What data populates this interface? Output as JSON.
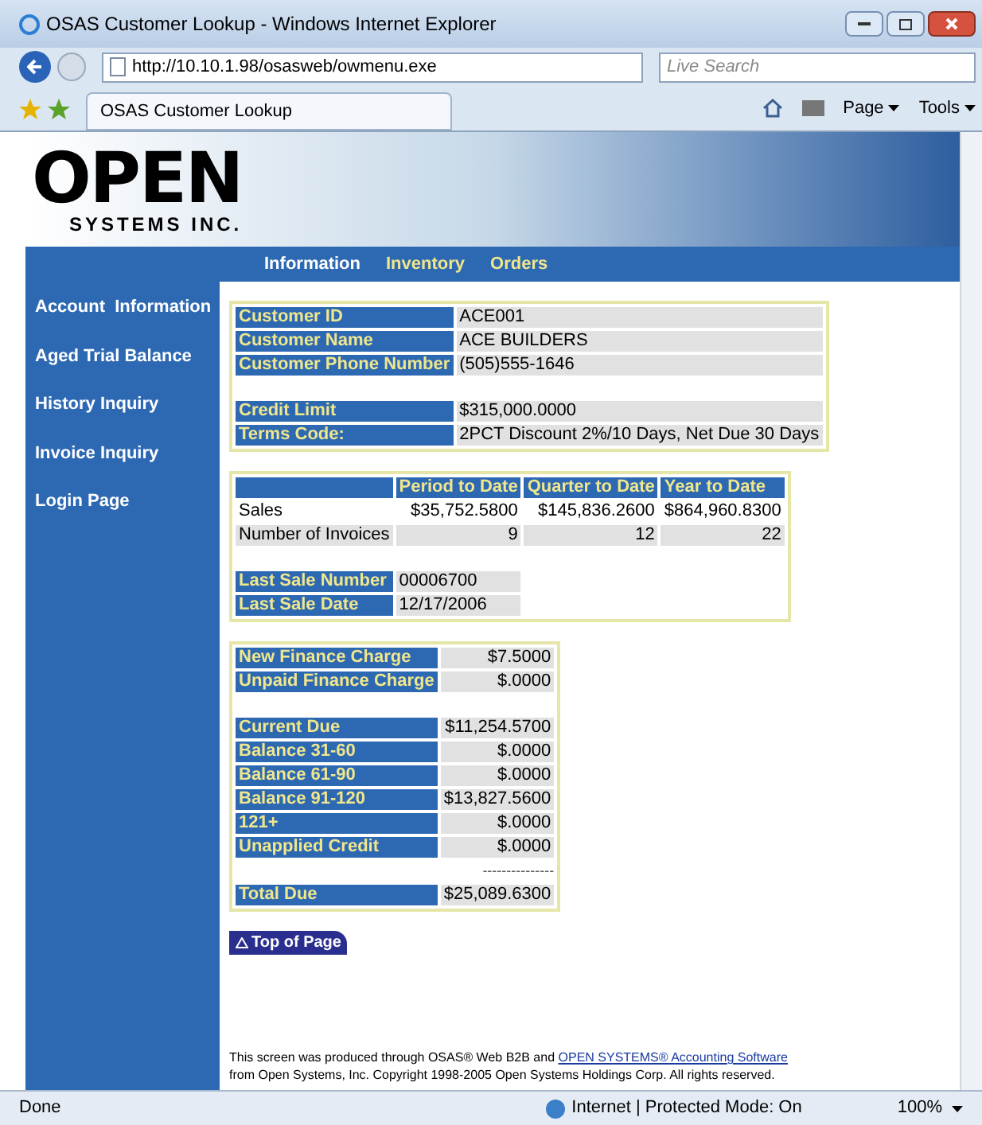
{
  "window": {
    "title": "OSAS Customer Lookup - Windows Internet Explorer"
  },
  "address_bar": {
    "url": "http://10.10.1.98/osasweb/owmenu.exe"
  },
  "search": {
    "placeholder": "Live Search"
  },
  "tabs": [
    {
      "label": "OSAS Customer Lookup",
      "selected": true
    }
  ],
  "command_bar": [
    "Page",
    "Tools"
  ],
  "logo": {
    "word": "OPEN",
    "tagline": "SYSTEMS INC."
  },
  "nav": [
    {
      "label": "Information",
      "selected": true
    },
    {
      "label": "Inventory",
      "selected": false
    },
    {
      "label": "Orders",
      "selected": false
    }
  ],
  "sidebar": {
    "items": [
      "Account  Information",
      "Aged Trial Balance",
      "History Inquiry",
      "Invoice Inquiry",
      "Login Page"
    ]
  },
  "customer": {
    "groups": [
      [
        {
          "label": "Customer ID",
          "value": "ACE001"
        },
        {
          "label": "Customer Name",
          "value": "ACE BUILDERS"
        },
        {
          "label": "Customer Phone Number",
          "value": "(505)555-1646"
        }
      ],
      [
        {
          "label": "Credit Limit",
          "value": "$315,000.0000"
        },
        {
          "label": "Terms Code:",
          "value": "2PCT Discount 2%/10 Days, Net Due 30 Days"
        }
      ]
    ]
  },
  "sales": {
    "columns": [
      "Period to Date",
      "Quarter to Date",
      "Year to Date"
    ],
    "rows": [
      {
        "label": "Sales",
        "values": [
          "$35,752.5800",
          "$145,836.2600",
          "$864,960.8300"
        ]
      },
      {
        "label": "Number of Invoices",
        "values": [
          "9",
          "12",
          "22"
        ]
      }
    ],
    "last_sale": [
      {
        "label": "Last Sale Number",
        "value": "00006700"
      },
      {
        "label": "Last Sale Date",
        "value": "12/17/2006"
      }
    ]
  },
  "aging": {
    "groups": [
      [
        {
          "label": "New Finance Charge",
          "value": "$7.5000"
        },
        {
          "label": "Unpaid Finance Charge",
          "value": "$.0000"
        }
      ],
      [
        {
          "label": "Current Due",
          "value": "$11,254.5700"
        },
        {
          "label": "Balance 31-60",
          "value": "$.0000"
        },
        {
          "label": "Balance 61-90",
          "value": "$.0000"
        },
        {
          "label": "Balance 91-120",
          "value": "$13,827.5600"
        },
        {
          "label": "121+",
          "value": "$.0000"
        },
        {
          "label": "Unapplied Credit",
          "value": "$.0000"
        }
      ]
    ],
    "rule": "---------------",
    "total": {
      "label": "Total Due",
      "value": "$25,089.6300"
    }
  },
  "top_button": "Top of Page",
  "footer": {
    "line1": "This screen was produced through OSAS® Web B2B and",
    "link": "OPEN SYSTEMS® Accounting Software",
    "line2": "from Open Systems, Inc. Copyright 1998-2005 Open Systems Holdings Corp. All rights reserved."
  },
  "status_bar": {
    "text": "Done",
    "zone": "Internet | Protected Mode: On",
    "zoom": "100%"
  }
}
